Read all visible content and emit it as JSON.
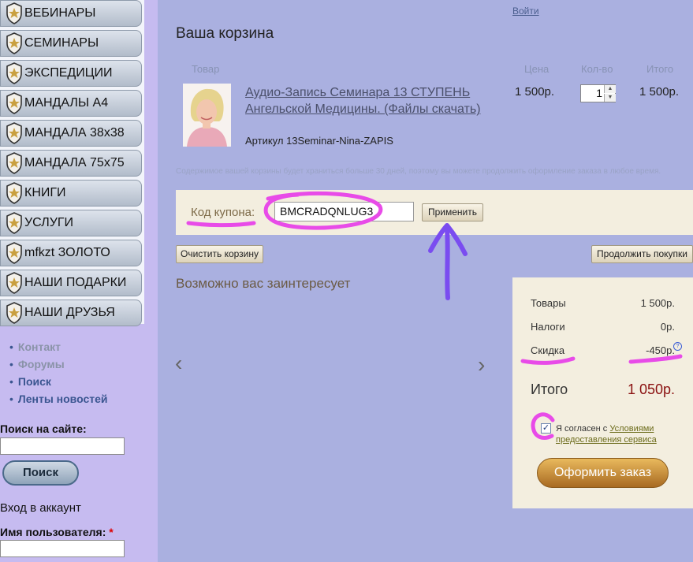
{
  "sidebar": {
    "menu": [
      {
        "label": "ВЕБИНАРЫ"
      },
      {
        "label": "СЕМИНАРЫ"
      },
      {
        "label": "ЭКСПЕДИЦИИ"
      },
      {
        "label": "МАНДАЛЫ А4"
      },
      {
        "label": "МАНДАЛА 38х38"
      },
      {
        "label": "МАНДАЛА 75х75"
      },
      {
        "label": "КНИГИ"
      },
      {
        "label": "УСЛУГИ"
      },
      {
        "label": "mfkzt ЗОЛОТО"
      },
      {
        "label": "НАШИ ПОДАРКИ"
      },
      {
        "label": "НАШИ ДРУЗЬЯ"
      }
    ],
    "links": [
      "Контакт",
      "Форумы",
      "Поиск",
      "Ленты новостей"
    ],
    "search_label": "Поиск на сайте:",
    "search_button": "Поиск",
    "login_heading": "Вход в аккаунт",
    "username_label": "Имя пользователя:",
    "required_mark": "*"
  },
  "header": {
    "login_link": "Войти"
  },
  "cart": {
    "title": "Ваша корзина",
    "columns": {
      "product": "Товар",
      "price": "Цена",
      "qty": "Кол-во",
      "total": "Итого"
    },
    "item": {
      "name": "Аудио-Запись Семинара 13 СТУПЕНЬ Ангельской Медицины. (Файлы скачать)",
      "sku": "Артикул 13Seminar-Nina-ZAPIS",
      "price": "1 500р.",
      "qty": "1",
      "total": "1 500р."
    },
    "notice": "Содержимое вашей корзины будет храниться больше 30 дней, поэтому вы можете продолжить оформление заказа в любое время.",
    "coupon": {
      "label": "Код купона:",
      "value": "BMCRADQNLUG3",
      "apply": "Применить"
    },
    "clear_button": "Очистить корзину",
    "continue_button": "Продолжить покупки",
    "interest_heading": "Возможно вас заинтересует",
    "prev_glyph": "‹",
    "next_glyph": "›"
  },
  "summary": {
    "goods_label": "Товары",
    "goods_value": "1 500р.",
    "tax_label": "Налоги",
    "tax_value": "0р.",
    "discount_label": "Скидка",
    "discount_value": "-450р.",
    "help_glyph": "?",
    "total_label": "Итого",
    "total_value": "1 050р.",
    "agree_check": "✓",
    "agree_prefix": "Я согласен с ",
    "agree_link": "Условиями предоставления сервиса",
    "checkout_button": "Оформить заказ"
  },
  "colors": {
    "sidebar": "#c6bbf0",
    "main": "#aab0e0",
    "panel": "#f3eedf",
    "accent": "#8a1010",
    "annotation": "#e84be8",
    "arrow": "#7a4cf0"
  }
}
